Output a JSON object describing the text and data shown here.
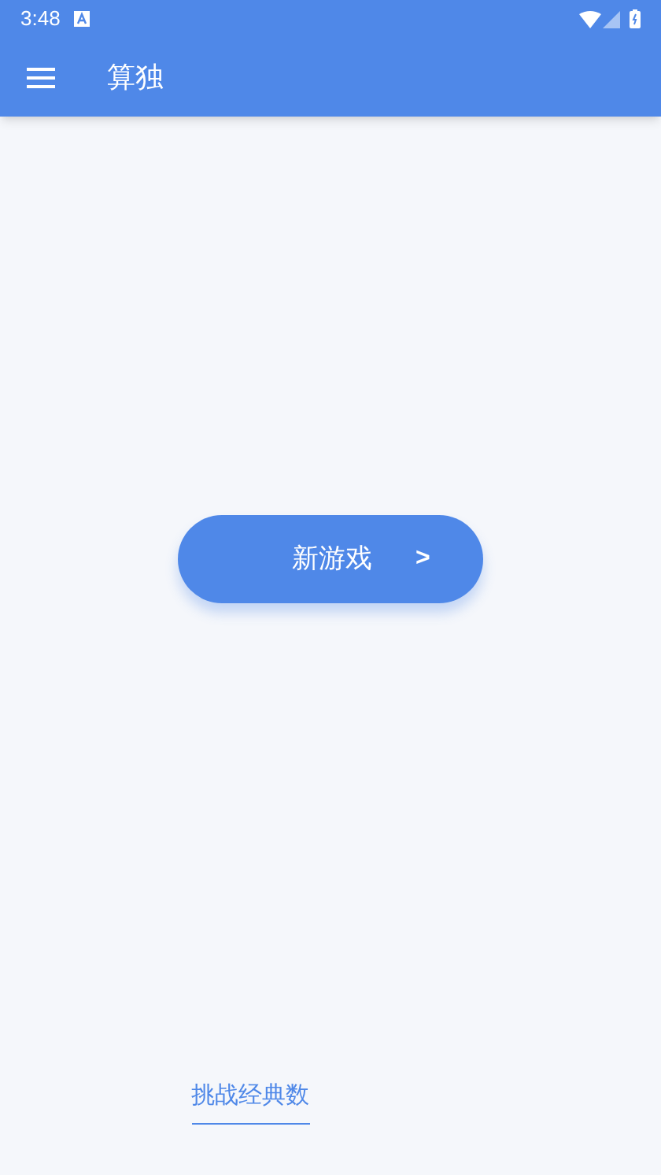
{
  "status_bar": {
    "time": "3:48"
  },
  "app_bar": {
    "title": "算独"
  },
  "new_game_button": {
    "label": "新游戏",
    "arrow": ">"
  },
  "classic_link": {
    "label": "挑战经典数"
  }
}
